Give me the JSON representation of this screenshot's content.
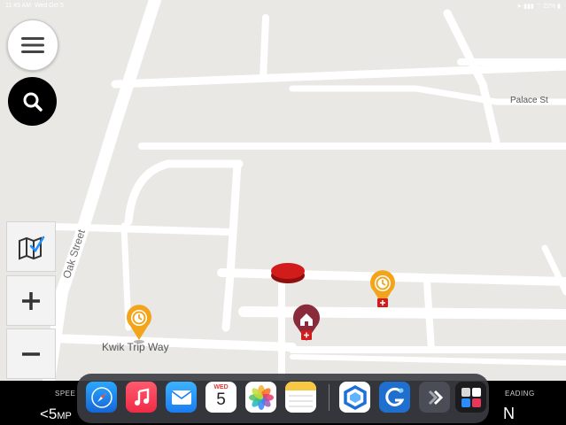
{
  "status_bar": {
    "time": "11:49 AM",
    "date": "Wed Oct 5",
    "battery": "22%"
  },
  "map": {
    "streets": {
      "oak": "Oak Street",
      "kwik": "Kwik Trip Way",
      "palace": "Palace St"
    }
  },
  "controls": {
    "menu_icon": "hamburger-icon",
    "search_icon": "search-icon",
    "layers_icon": "map-layers-icon",
    "zoom_in_icon": "plus-icon",
    "zoom_out_icon": "minus-icon"
  },
  "telemetry": {
    "speed_label": "SPEE",
    "speed_value": "<5",
    "speed_unit": "MP",
    "heading_label": "EADING",
    "heading_value": "N"
  },
  "dock": {
    "apps": [
      "safari",
      "music",
      "mail",
      "calendar",
      "photos",
      "notes",
      "app-hexagon",
      "app-blue-g",
      "app-arrow",
      "app-grid"
    ],
    "calendar_day": "WED",
    "calendar_date": "5"
  },
  "colors": {
    "map_bg": "#e9e8e5",
    "road": "#ffffff",
    "pin_orange": "#f2a51a",
    "pin_maroon": "#8a2b3c",
    "marker_red": "#d21b1b"
  }
}
